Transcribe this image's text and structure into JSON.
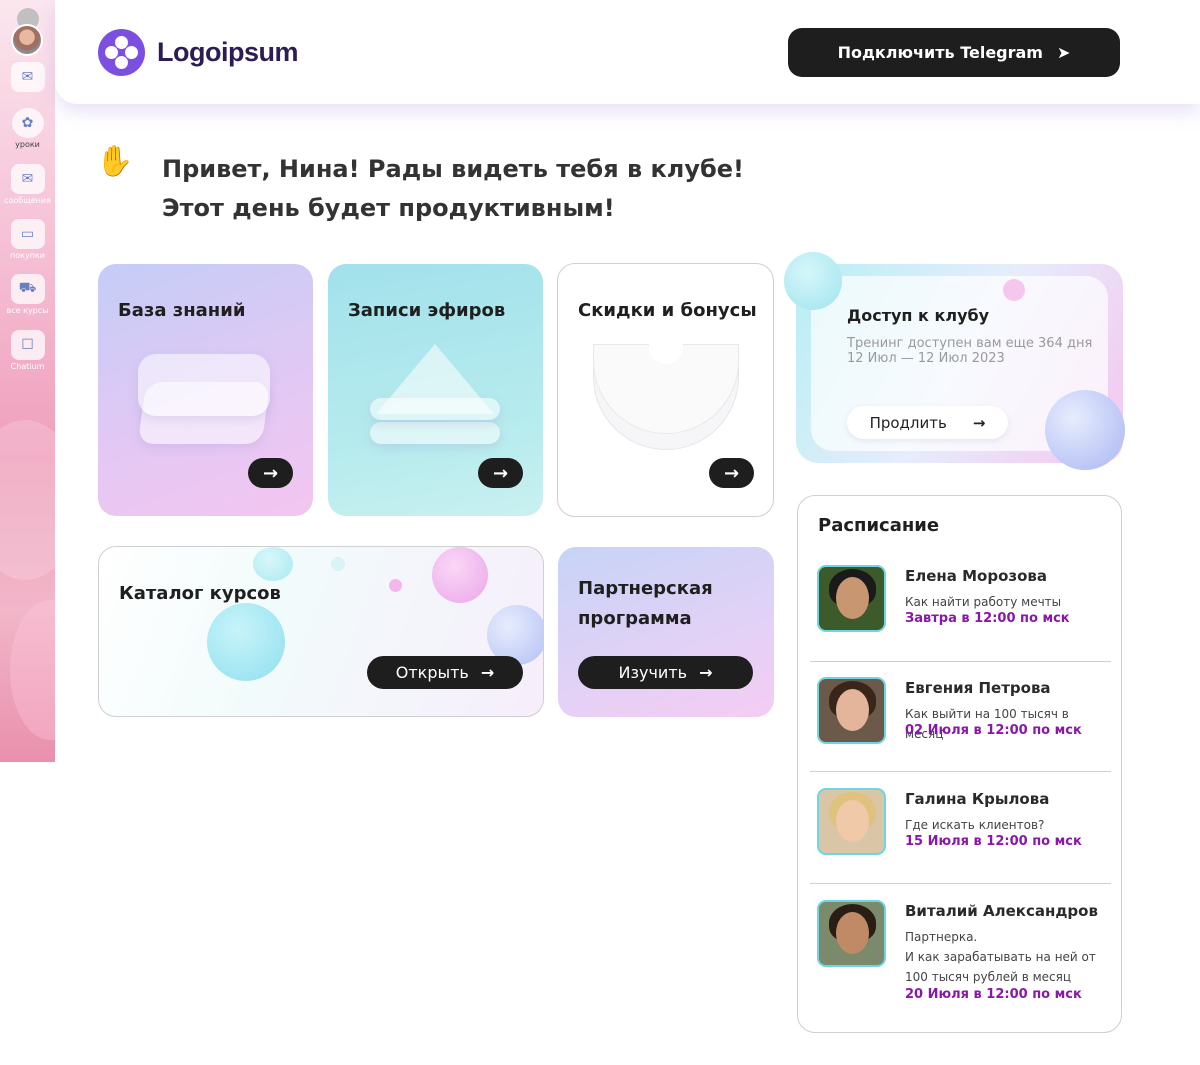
{
  "sidebar": {
    "items": [
      {
        "label": "",
        "icon": "chat-bubble-icon"
      },
      {
        "label": "уроки",
        "icon": "flower-icon"
      },
      {
        "label": "сообщения",
        "icon": "envelope-hands-icon"
      },
      {
        "label": "покупки",
        "icon": "card-icon"
      },
      {
        "label": "все курсы",
        "icon": "cart-icon"
      },
      {
        "label": "Chatium",
        "icon": "phone-icon"
      }
    ]
  },
  "header": {
    "logo_text": "Logoipsum",
    "telegram_button": "Подключить Telegram"
  },
  "greeting": {
    "line1": "Привет, Нина! Рады видеть тебя в клубе!",
    "line2": "Этот день будет продуктивным!"
  },
  "cards": {
    "knowledge": {
      "title": "База знаний"
    },
    "recordings": {
      "title": "Записи эфиров"
    },
    "discounts": {
      "title": "Скидки и бонусы"
    },
    "catalog": {
      "title": "Каталог курсов",
      "button": "Открыть"
    },
    "partner": {
      "title_line1": "Партнерская",
      "title_line2": "программа",
      "button": "Изучить"
    }
  },
  "access": {
    "title": "Доступ к клубу",
    "subtitle_line1": "Тренинг доступен вам еще 364 дня",
    "subtitle_line2": "12 Июл — 12 Июл 2023",
    "button": "Продлить"
  },
  "schedule": {
    "title": "Расписание",
    "items": [
      {
        "name": "Елена Морозова",
        "desc_lines": [
          "Как найти работу мечты"
        ],
        "time": "Завтра в 12:00 по мск"
      },
      {
        "name": "Евгения Петрова",
        "desc_lines": [
          "Как выйти на 100 тысяч в месяц"
        ],
        "time": "02 Июля в 12:00 по мск"
      },
      {
        "name": "Галина Крылова",
        "desc_lines": [
          "Где искать клиентов?"
        ],
        "time": "15 Июля в 12:00 по мск"
      },
      {
        "name": "Виталий Александров",
        "desc_lines": [
          "Партнерка.",
          "И как зарабатывать на ней от",
          "100 тысяч рублей в месяц"
        ],
        "time": "20 Июля в 12:00 по мск"
      }
    ]
  },
  "colors": {
    "accent": "#7b4fe0",
    "time_text": "#8a17a8",
    "dark_button": "#1e1e1e",
    "photo_border": "#6fd5e3"
  }
}
